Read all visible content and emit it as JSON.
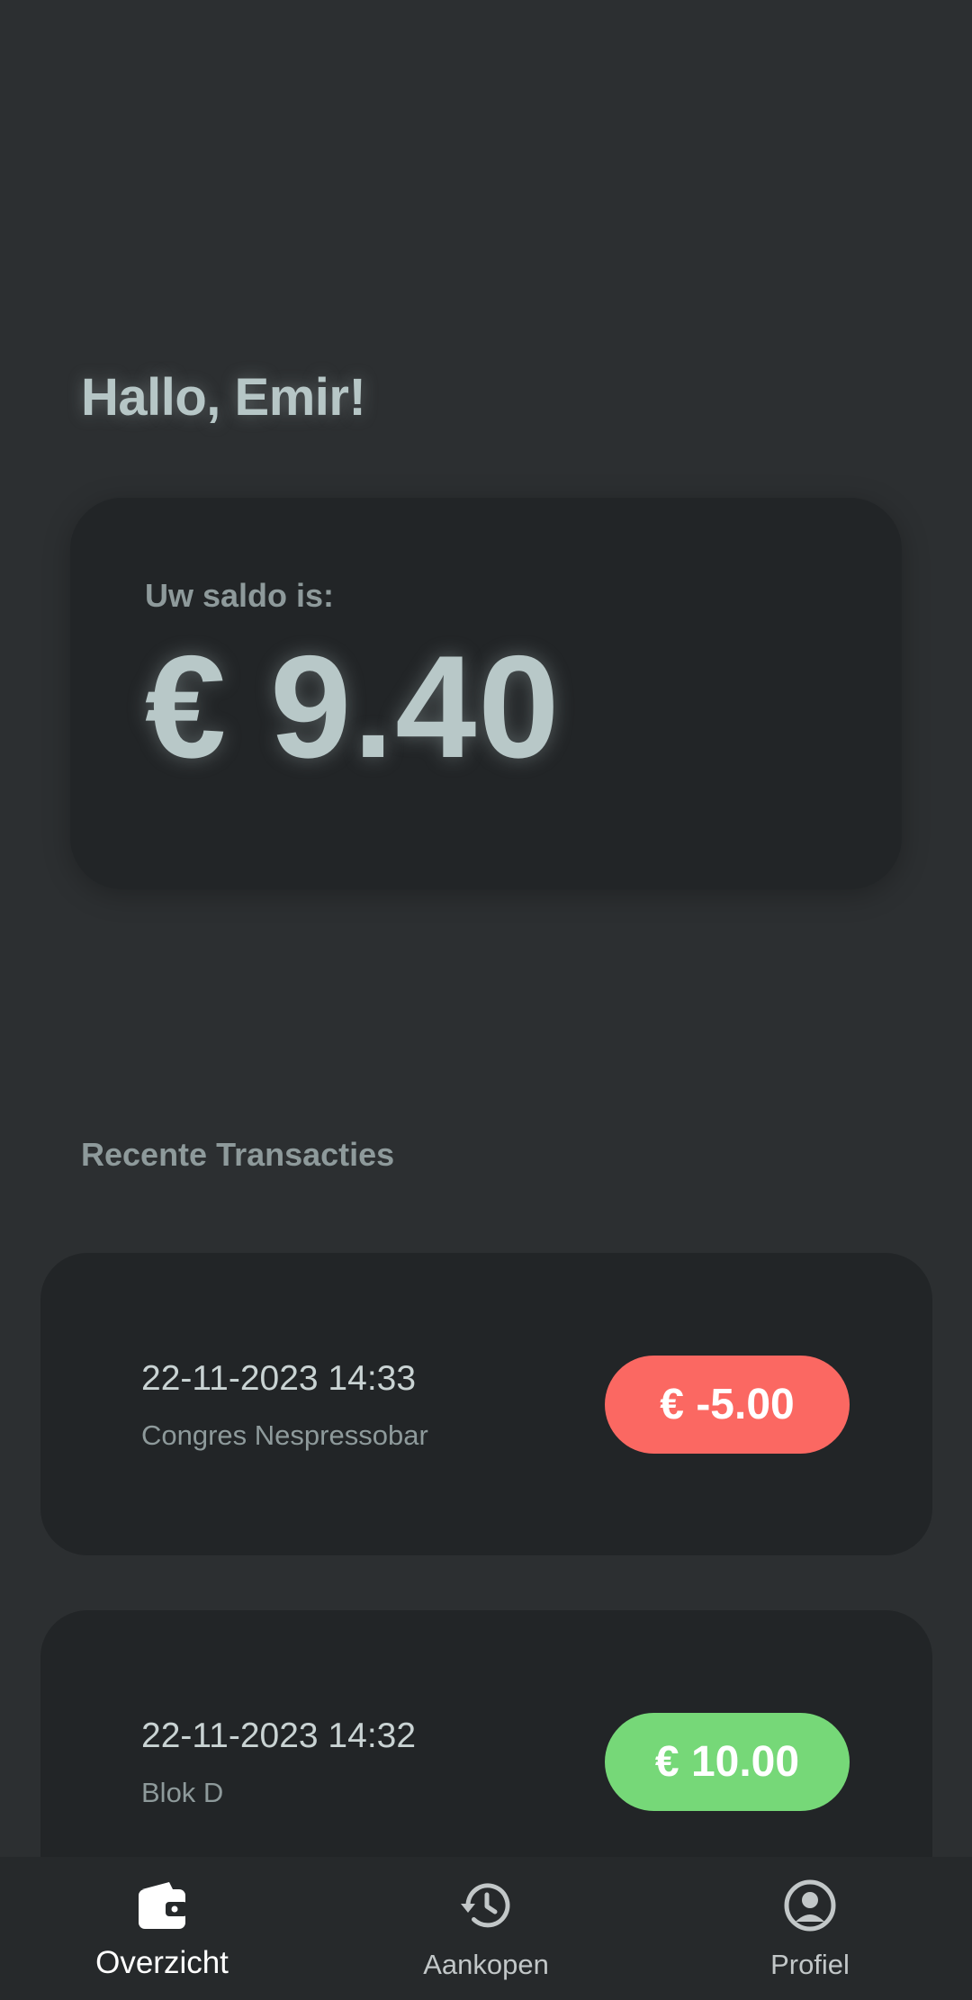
{
  "greeting": "Hallo, Emir!",
  "balance": {
    "label": "Uw saldo is:",
    "amount": "€ 9.40"
  },
  "transactions": {
    "title": "Recente Transacties",
    "items": [
      {
        "datetime": "22-11-2023 14:33",
        "description": "Congres Nespressobar",
        "amount": "€ -5.00",
        "status_color": "#fb6862"
      },
      {
        "datetime": "22-11-2023 14:32",
        "description": "Blok D",
        "amount": "€ 10.00",
        "status_color": "#76d878"
      }
    ]
  },
  "nav": {
    "items": [
      {
        "label": "Overzicht",
        "icon": "wallet-icon",
        "active": true
      },
      {
        "label": "Aankopen",
        "icon": "history-icon",
        "active": false
      },
      {
        "label": "Profiel",
        "icon": "account-circle-icon",
        "active": false
      }
    ]
  },
  "colors": {
    "background": "#2c2f31",
    "card": "#222527",
    "accent_text": "#b8c8c8",
    "negative": "#fb6862",
    "positive": "#76d878"
  }
}
